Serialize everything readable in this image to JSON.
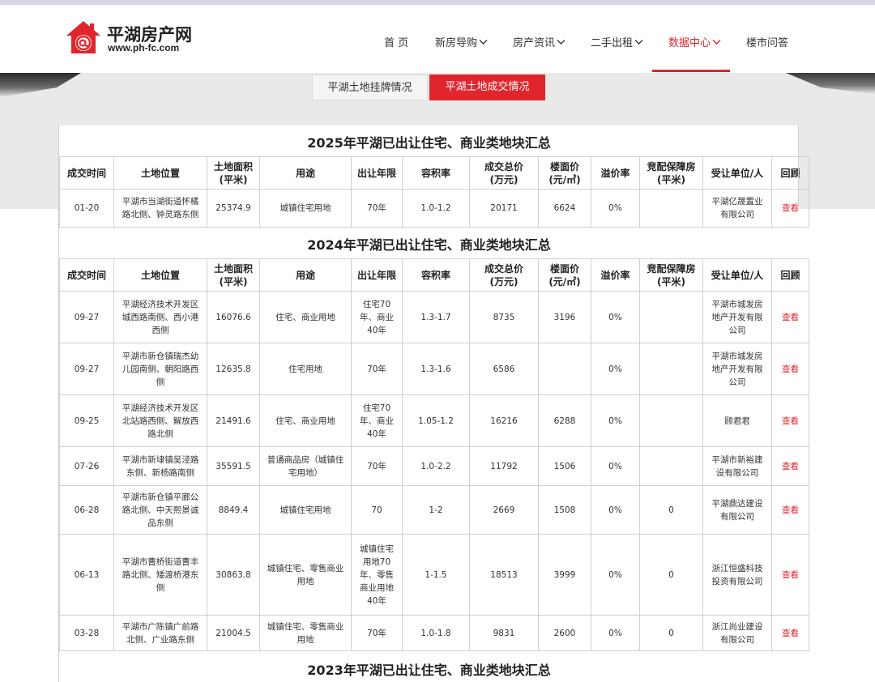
{
  "site": {
    "title": "平湖房产网",
    "url": "www.ph-fc.com",
    "logo_icon": "house-at-icon",
    "brand_color": "#e0252d"
  },
  "nav": {
    "items": [
      {
        "label": "首 页",
        "dropdown": false
      },
      {
        "label": "新房导购",
        "dropdown": true
      },
      {
        "label": "房产资讯",
        "dropdown": true
      },
      {
        "label": "二手出租",
        "dropdown": true
      },
      {
        "label": "数据中心",
        "dropdown": true,
        "active": true
      },
      {
        "label": "楼市问答",
        "dropdown": false
      }
    ]
  },
  "tabs": [
    {
      "label": "平湖土地挂牌情况",
      "active": false
    },
    {
      "label": "平湖土地成交情况",
      "active": true
    }
  ],
  "headers": [
    "成交时间",
    "土地位置",
    "土地面积\n(平米)",
    "用途",
    "出让年限",
    "容积率",
    "成交总价\n(万元)",
    "楼面价\n(元/㎡)",
    "溢价率",
    "竞配保障房\n(平米)",
    "受让单位/人",
    "回顾"
  ],
  "sections": [
    {
      "title": "2025年平湖已出让住宅、商业类地块汇总",
      "rows": [
        {
          "date": "01-20",
          "location": "平湖市当湖街道怀橘路北侧、钟灵路东侧",
          "area": "25374.9",
          "use": "城镇住宅用地",
          "term": "70年",
          "far": "1.0-1.2",
          "total": "20171",
          "floor": "6624",
          "premium": "0%",
          "housing": "",
          "buyer": "平湖亿晟置业有限公司",
          "link": "查看"
        }
      ]
    },
    {
      "title": "2024年平湖已出让住宅、商业类地块汇总",
      "rows": [
        {
          "date": "09-27",
          "location": "平湖经济技术开发区城西路南侧、西小港西侧",
          "area": "16076.6",
          "use": "住宅、商业用地",
          "term": "住宅70年、商业40年",
          "far": "1.3-1.7",
          "total": "8735",
          "floor": "3196",
          "premium": "0%",
          "housing": "",
          "buyer": "平湖市城发房地产开发有限公司",
          "link": "查看"
        },
        {
          "date": "09-27",
          "location": "平湖市新仓镇瑞杰幼儿园南侧、朝阳路西侧",
          "area": "12635.8",
          "use": "住宅用地",
          "term": "70年",
          "far": "1.3-1.6",
          "total": "6586",
          "floor": "",
          "premium": "0%",
          "housing": "",
          "buyer": "平湖市城发房地产开发有限公司",
          "link": "查看"
        },
        {
          "date": "09-25",
          "location": "平湖经济技术开发区北站路西侧、解放西路北侧",
          "area": "21491.6",
          "use": "住宅、商业用地",
          "term": "住宅70年、商业40年",
          "far": "1.05-1.2",
          "total": "16216",
          "floor": "6288",
          "premium": "0%",
          "housing": "",
          "buyer": "顾君君",
          "link": "查看"
        },
        {
          "date": "07-26",
          "location": "平湖市新埭镇吴泾路东侧、新杨路南侧",
          "area": "35591.5",
          "use": "普通商品房（城镇住宅用地）",
          "term": "70年",
          "far": "1.0-2.2",
          "total": "11792",
          "floor": "1506",
          "premium": "0%",
          "housing": "",
          "buyer": "平湖市新裕建设有限公司",
          "link": "查看"
        },
        {
          "date": "06-28",
          "location": "平湖市新仓镇平廊公路北侧、中天熙景诚品东侧",
          "area": "8849.4",
          "use": "城镇住宅用地",
          "term": "70",
          "far": "1-2",
          "total": "2669",
          "floor": "1508",
          "premium": "0%",
          "housing": "0",
          "buyer": "平湖鼎达建设有限公司",
          "link": "查看"
        },
        {
          "date": "06-13",
          "location": "平湖市曹桥街道曹丰路北侧、矮渡桥港东侧",
          "area": "30863.8",
          "use": "城镇住宅、零售商业用地",
          "term": "城镇住宅用地70年、零售商业用地40年",
          "far": "1-1.5",
          "total": "18513",
          "floor": "3999",
          "premium": "0%",
          "housing": "0",
          "buyer": "浙江恒盛科技投资有限公司",
          "link": "查看"
        },
        {
          "date": "03-28",
          "location": "平湖市广陈镇广前路北侧、广业路东侧",
          "area": "21004.5",
          "use": "城镇住宅、零售商业用地",
          "term": "70年",
          "far": "1.0-1.8",
          "total": "9831",
          "floor": "2600",
          "premium": "0%",
          "housing": "0",
          "buyer": "浙江尚业建设有限公司",
          "link": "查看"
        }
      ]
    },
    {
      "title": "2023年平湖已出让住宅、商业类地块汇总",
      "rows": []
    }
  ]
}
